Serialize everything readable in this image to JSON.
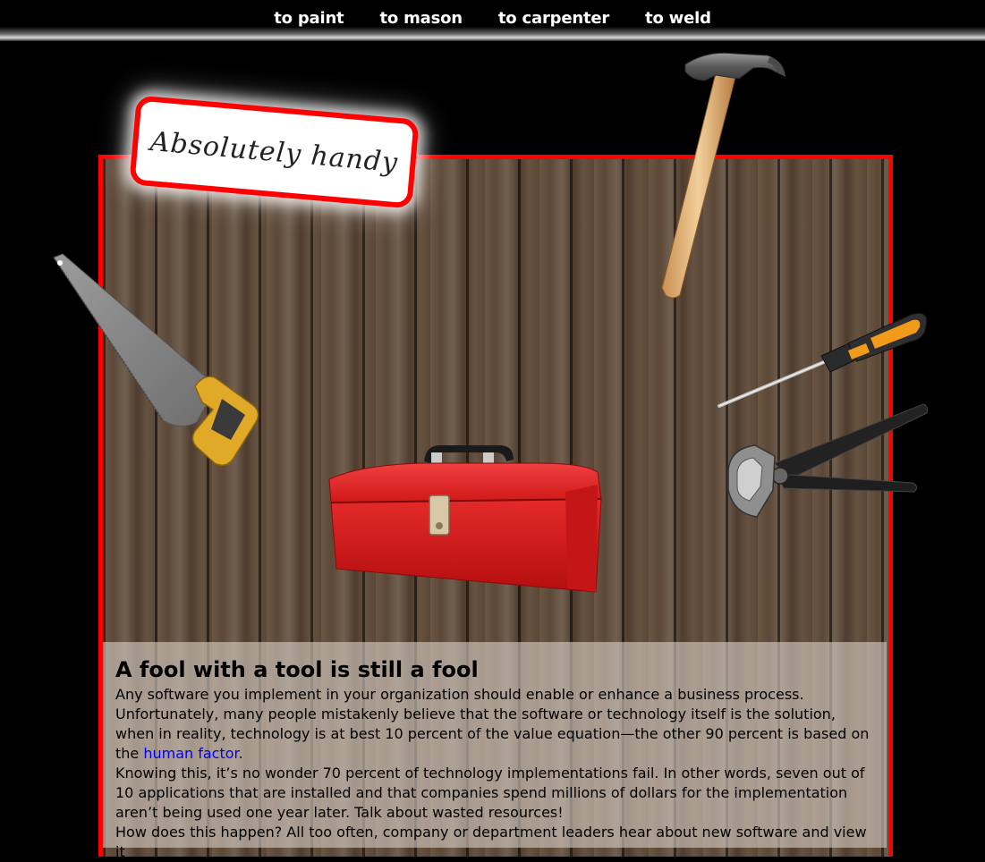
{
  "nav": {
    "items": [
      {
        "label": "to paint"
      },
      {
        "label": "to mason"
      },
      {
        "label": "to carpenter"
      },
      {
        "label": "to weld"
      }
    ]
  },
  "logo": {
    "text": "Absolutely handy"
  },
  "colors": {
    "accent": "#ff0000",
    "background": "#000000",
    "link": "#0000ee"
  },
  "icons": [
    "hammer-icon",
    "saw-icon",
    "screwdriver-icon",
    "pliers-icon",
    "toolbox-icon"
  ],
  "article": {
    "title": "A fool with a tool is still a fool",
    "p1_before": "Any software you implement in your organization should enable or enhance a business process. Unfortunately, many people mistakenly believe that the software or technology itself is the solution, when in reality, technology is at best 10 percent of the value equation—the other 90 percent is based on the ",
    "p1_link": "human factor",
    "p1_after": ".",
    "p2": "Knowing this, it’s no wonder 70 percent of technology implementations fail. In other words, seven out of 10 applications that are installed and that companies spend millions of dollars for the implementation aren’t being used one year later. Talk about wasted resources!",
    "p3": "How does this happen? All too often, company or department leaders hear about new software and view it"
  }
}
